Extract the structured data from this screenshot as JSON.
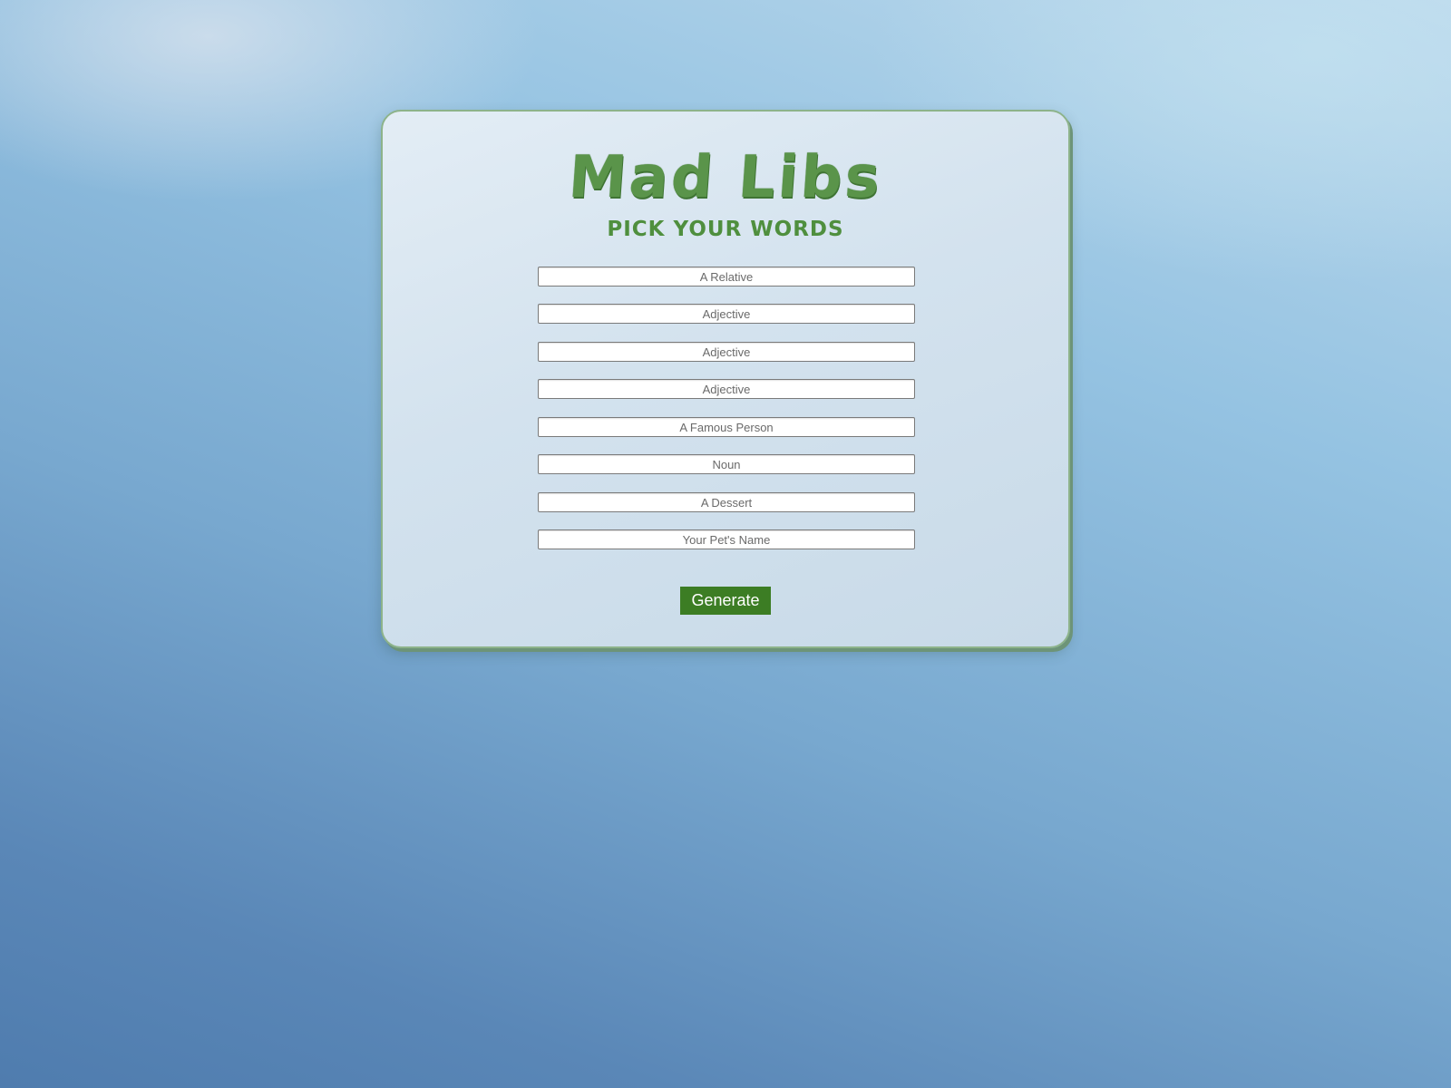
{
  "app": {
    "title": "Mad Libs",
    "subtitle": "Pick Your Words"
  },
  "form": {
    "fields": [
      {
        "placeholder": "A Relative",
        "value": ""
      },
      {
        "placeholder": "Adjective",
        "value": ""
      },
      {
        "placeholder": "Adjective",
        "value": ""
      },
      {
        "placeholder": "Adjective",
        "value": ""
      },
      {
        "placeholder": "A Famous Person",
        "value": ""
      },
      {
        "placeholder": "Noun",
        "value": ""
      },
      {
        "placeholder": "A Dessert",
        "value": ""
      },
      {
        "placeholder": "Your Pet's Name",
        "value": ""
      }
    ],
    "submit_label": "Generate"
  },
  "colors": {
    "accent": "#3c7d24",
    "title": "#5a944a",
    "card_border": "#8db38a"
  }
}
